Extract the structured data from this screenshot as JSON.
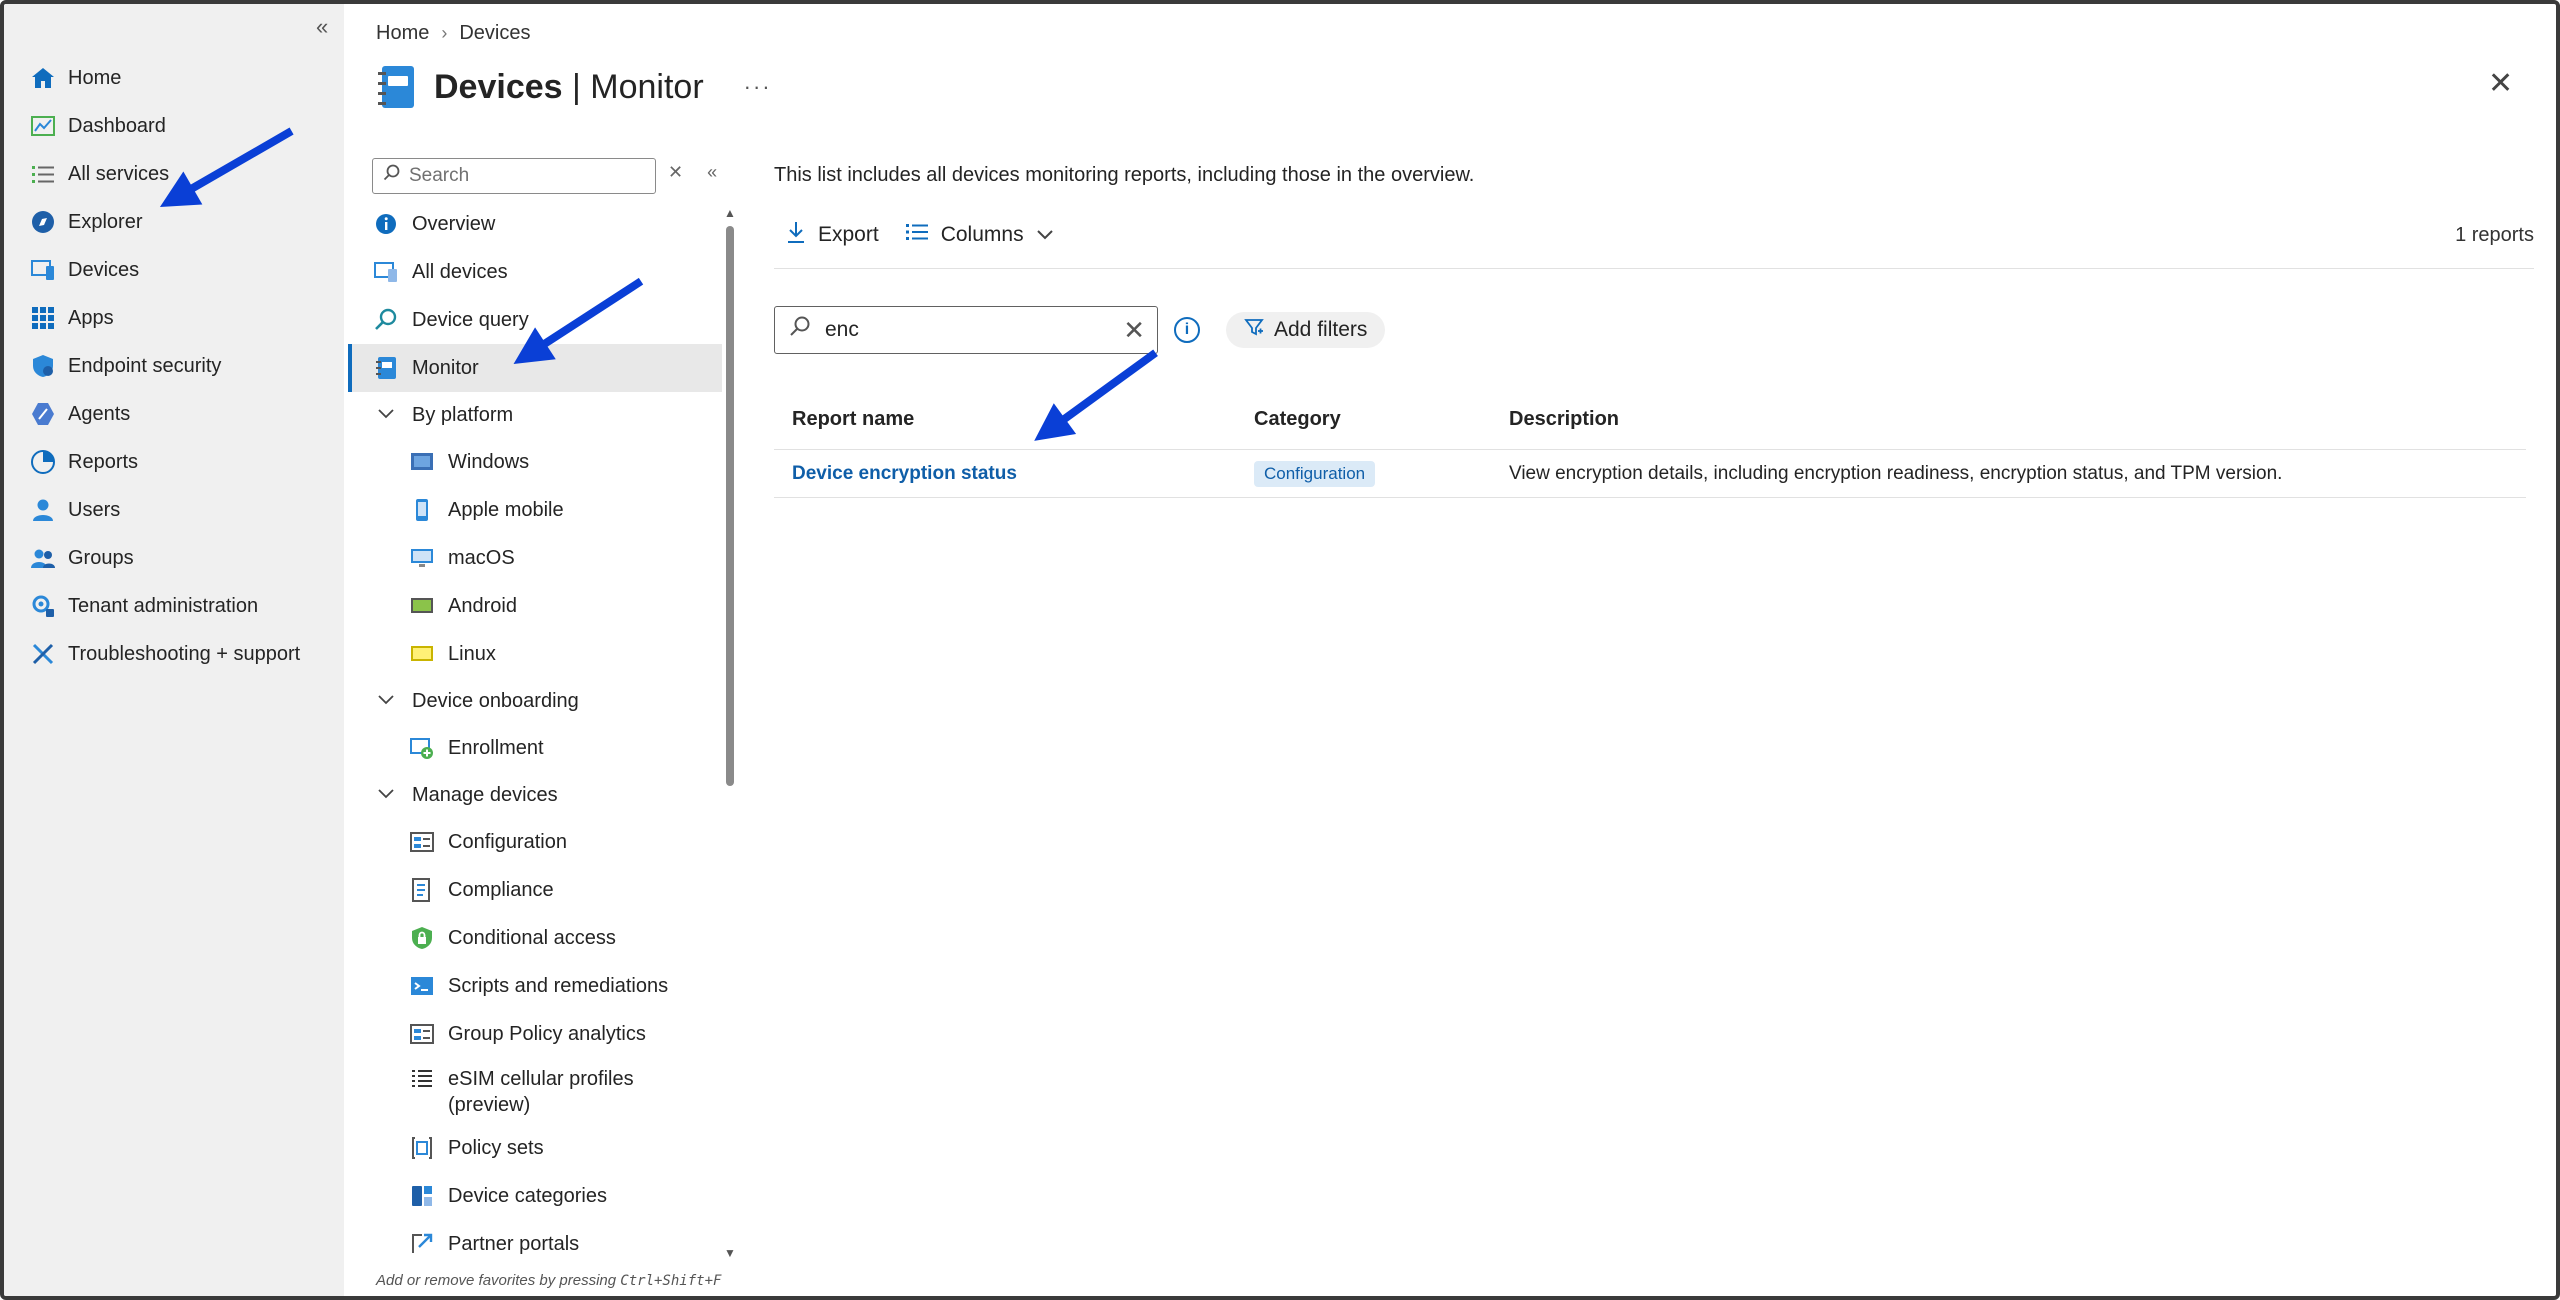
{
  "global_nav": {
    "collapse_symbol": "«",
    "items": [
      {
        "label": "Home",
        "icon": "home-icon",
        "color": "#0f6cbd"
      },
      {
        "label": "Dashboard",
        "icon": "dashboard-icon",
        "color": "#4caf50"
      },
      {
        "label": "All services",
        "icon": "list-icon",
        "color": "#4caf50"
      },
      {
        "label": "Explorer",
        "icon": "explorer-icon",
        "color": "#1e5fa8"
      },
      {
        "label": "Devices",
        "icon": "devices-icon",
        "color": "#2b88d8"
      },
      {
        "label": "Apps",
        "icon": "apps-icon",
        "color": "#0f6cbd"
      },
      {
        "label": "Endpoint security",
        "icon": "shield-icon",
        "color": "#2b88d8"
      },
      {
        "label": "Agents",
        "icon": "agents-icon",
        "color": "#4a7bd0"
      },
      {
        "label": "Reports",
        "icon": "reports-icon",
        "color": "#0f6cbd"
      },
      {
        "label": "Users",
        "icon": "user-icon",
        "color": "#2b88d8"
      },
      {
        "label": "Groups",
        "icon": "groups-icon",
        "color": "#2b88d8"
      },
      {
        "label": "Tenant administration",
        "icon": "gear-icon",
        "color": "#2b88d8"
      },
      {
        "label": "Troubleshooting + support",
        "icon": "tools-icon",
        "color": "#2b88d8"
      }
    ]
  },
  "breadcrumb": {
    "home": "Home",
    "sep": "›",
    "current": "Devices"
  },
  "header": {
    "title_main": "Devices",
    "title_sep": " | ",
    "title_sub": "Monitor",
    "more": "···",
    "close": "✕"
  },
  "secondary_nav": {
    "search_placeholder": "Search",
    "clear_symbol": "✕",
    "collapse_symbol": "«",
    "items": [
      {
        "label": "Overview",
        "type": "item",
        "icon": "info-icon"
      },
      {
        "label": "All devices",
        "type": "item",
        "icon": "all-devices-icon"
      },
      {
        "label": "Device query",
        "type": "item",
        "icon": "device-query-icon"
      },
      {
        "label": "Monitor",
        "type": "item",
        "icon": "monitor-icon",
        "selected": true
      },
      {
        "label": "By platform",
        "type": "group"
      },
      {
        "label": "Windows",
        "type": "sub",
        "icon": "windows-icon"
      },
      {
        "label": "Apple mobile",
        "type": "sub",
        "icon": "apple-mobile-icon"
      },
      {
        "label": "macOS",
        "type": "sub",
        "icon": "macos-icon"
      },
      {
        "label": "Android",
        "type": "sub",
        "icon": "android-icon"
      },
      {
        "label": "Linux",
        "type": "sub",
        "icon": "linux-icon"
      },
      {
        "label": "Device onboarding",
        "type": "group"
      },
      {
        "label": "Enrollment",
        "type": "sub",
        "icon": "enrollment-icon"
      },
      {
        "label": "Manage devices",
        "type": "group"
      },
      {
        "label": "Configuration",
        "type": "sub",
        "icon": "configuration-icon"
      },
      {
        "label": "Compliance",
        "type": "sub",
        "icon": "compliance-icon"
      },
      {
        "label": "Conditional access",
        "type": "sub",
        "icon": "lock-icon"
      },
      {
        "label": "Scripts and remediations",
        "type": "sub",
        "icon": "scripts-icon"
      },
      {
        "label": "Group Policy analytics",
        "type": "sub",
        "icon": "group-policy-icon"
      },
      {
        "label": "eSIM cellular profiles (preview)",
        "type": "sub",
        "icon": "esim-icon",
        "two_line": true
      },
      {
        "label": "Policy sets",
        "type": "sub",
        "icon": "policy-sets-icon"
      },
      {
        "label": "Device categories",
        "type": "sub",
        "icon": "device-categories-icon"
      },
      {
        "label": "Partner portals",
        "type": "sub",
        "icon": "partner-portals-icon"
      }
    ],
    "fav_hint_prefix": "Add or remove favorites by pressing ",
    "fav_hint_kbd": "Ctrl+Shift+F"
  },
  "main": {
    "intro": "This list includes all devices monitoring reports, including those in the overview.",
    "toolbar": {
      "export_label": "Export",
      "columns_label": "Columns"
    },
    "report_count": "1 reports",
    "filter": {
      "value": "enc",
      "add_filters_label": "Add filters",
      "info_symbol": "i"
    },
    "table": {
      "headers": {
        "name": "Report name",
        "category": "Category",
        "description": "Description"
      },
      "rows": [
        {
          "name": "Device encryption status",
          "category": "Configuration",
          "description": "View encryption details, including encryption readiness, encryption status, and TPM version."
        }
      ]
    }
  },
  "colors": {
    "accent": "#0f6cbd",
    "annotation_arrow": "#0a3fd6",
    "selected_bg": "#e8e8e8",
    "nav_bg": "#f0f0f0"
  }
}
